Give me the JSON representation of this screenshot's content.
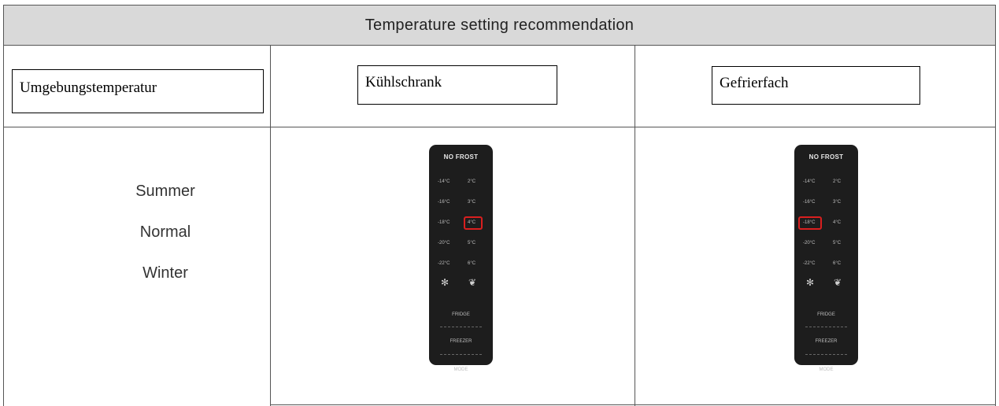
{
  "title": "Temperature setting recommendation",
  "headers": {
    "ambient": "Umgebungstemperatur",
    "fridge": "Kühlschrank",
    "freezer": "Gefrierfach"
  },
  "seasons": [
    "Summer",
    "Normal",
    "Winter"
  ],
  "panel": {
    "brand": "NO FROST",
    "freezer_temps": [
      "-14°C",
      "-16°C",
      "-18°C",
      "-20°C",
      "-22°C"
    ],
    "fridge_temps": [
      "2°C",
      "3°C",
      "4°C",
      "5°C",
      "6°C"
    ],
    "buttons": [
      "FRIDGE",
      "FREEZER",
      "MODE"
    ],
    "icons": [
      "snowflake-icon",
      "vacation-icon"
    ]
  },
  "highlight_color": "#d91f1f"
}
